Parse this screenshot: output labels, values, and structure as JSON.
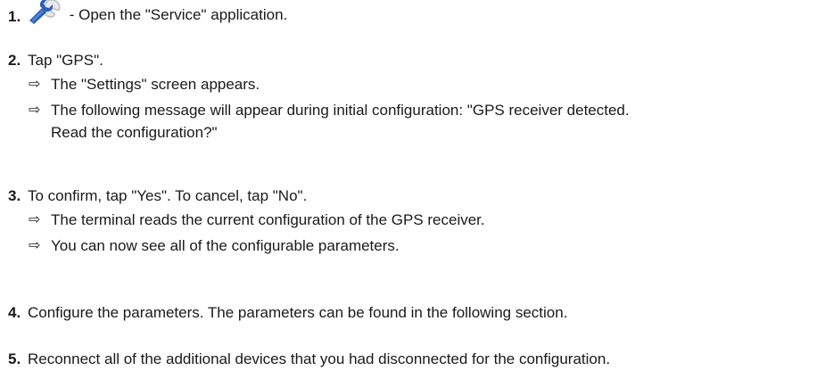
{
  "steps": [
    {
      "number": "1.",
      "icon": "wrench-icon",
      "text": " - Open the \"Service\" application.",
      "results": []
    },
    {
      "number": "2.",
      "text": "Tap \"GPS\".",
      "results": [
        "The \"Settings\" screen appears.",
        "The following message will appear during initial configuration: \"GPS receiver detected.",
        "Read the configuration?\""
      ]
    },
    {
      "number": "3.",
      "text": "To confirm, tap \"Yes\". To cancel, tap \"No\".",
      "results": [
        "The terminal reads the current configuration of the GPS receiver.",
        "You can now see all of the configurable parameters."
      ]
    },
    {
      "number": "4.",
      "text": "Configure the parameters. The parameters can be found in the following section.",
      "results": []
    },
    {
      "number": "5.",
      "text": "Reconnect all of the additional devices that you had disconnected for the configuration.",
      "results": []
    }
  ],
  "result_arrow": "⇨",
  "colors": {
    "text": "#1a1a1a",
    "icon_blue": "#2a5fb5",
    "icon_gray": "#b9bcc2"
  }
}
